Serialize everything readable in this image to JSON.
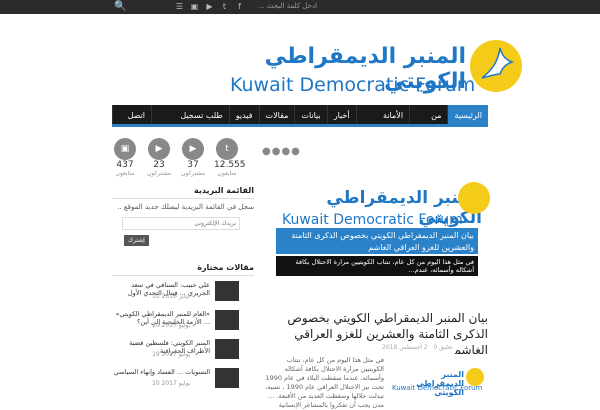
{
  "topbar": {
    "search_placeholder": "ادخل كلمة البحث ...",
    "social_icons": [
      "facebook-icon",
      "twitter-icon",
      "youtube-icon",
      "instagram-icon",
      "rss-icon"
    ]
  },
  "header": {
    "logo_arabic": "المنبر الديمقراطي الكويتي",
    "logo_english": "Kuwait Democratic Forum",
    "logo_color": "#1f77c6",
    "logo_accent": "#f5cb1a"
  },
  "nav": {
    "items": [
      "الرئيسية",
      "من نحن",
      "الأمانة العامة",
      "أخبار",
      "بيانات",
      "مقالات",
      "فيديو",
      "طلب تسجيل عضوية",
      "اتصل بنا"
    ],
    "accent": "#2b82c9"
  },
  "sidebar": {
    "social": [
      {
        "icon": "twitter-icon",
        "count": "12.555",
        "label": "متابعون"
      },
      {
        "icon": "youtube-icon",
        "count": "37",
        "label": "مشتركون"
      },
      {
        "icon": "youtube-icon",
        "count": "23",
        "label": "مشتركون"
      },
      {
        "icon": "instagram-icon",
        "count": "437",
        "label": "متابعون"
      }
    ],
    "newsletter_title": "القائمة البريدية",
    "newsletter_text": "سجل في القائمة البريدية ليصلك جديد الموقع ..",
    "email_placeholder": "بريدك الإلكتروني",
    "submit_label": "إشترك",
    "articles_title": "مقالات مختارة",
    "articles": [
      {
        "title": "علي حبيب: السنافي في سعد الجريري ... فيتال التحدي الأول",
        "date": "10 يناير 2016"
      },
      {
        "title": "«العام للمنبر الديمقراطي الكويتي» ... الأزمة الخليجية إلى أين؟",
        "date": "20 يوليو 2017"
      },
      {
        "title": "المنبر الكويتي: فلسطين قضية الأطراف الجغرافية",
        "date": "19 يوليو 2017"
      },
      {
        "title": "التسويات ... الفساد وإنهاء السياسي",
        "date": "10 يوليو 2017"
      }
    ]
  },
  "main": {
    "slider_caption": "بيان المنبر الديمقراطي الكويتي بخصوص الذكرى الثامنة والعشرين للغزو العراقي الغاشم",
    "slider_excerpt": "في مثل هذا اليوم من كل عام، تنتاب الكويتيين مرارة الاحتلال بكافة أشكاله وأسمائه، عندم...",
    "post_title": "بيان المنبر الديمقراطي الكويتي بخصوص الذكرى الثامنة والعشرين للغزو العراقي الغاشم",
    "post_date": "2 أغسطس 2018",
    "post_comments": "تعليق 0",
    "post_excerpt": "في مثل هذا اليوم من كل عام، تنتاب الكويتيين مرارة الاحتلال بكافة أشكاله وأسمائه، عندما سقطت البلاد في عام 1990 تحت نير الاحتلال العراقي عام 1990 ، نسيه، تبدلت خلالها وسقطت العديد من الأقنعة. ... مدن يجب أن تفكروا بالمشاعر الإنسانية"
  }
}
